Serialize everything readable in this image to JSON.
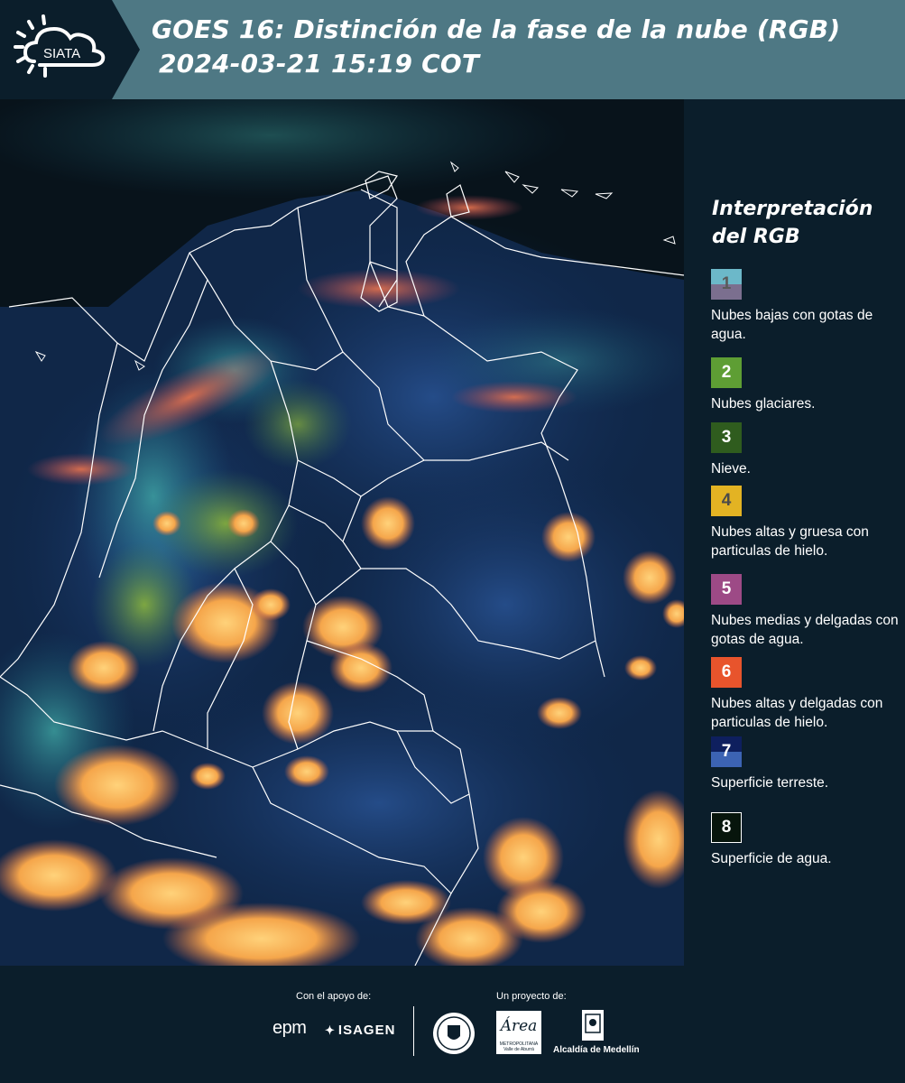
{
  "header": {
    "logo_text": "SIATA",
    "title_line1": "GOES 16: Distinción de la fase de la nube (RGB)",
    "title_line2": "2024-03-21 15:19 COT"
  },
  "legend": {
    "title_line1": "Interpretación",
    "title_line2": "del RGB",
    "items": [
      {
        "number": "1",
        "label": "Nubes bajas con gotas de agua.",
        "color_top": "#6cb8c9",
        "color_bottom": "#7b6f8f",
        "number_color": "#5a5a5a"
      },
      {
        "number": "2",
        "label": "Nubes glaciares.",
        "color_top": "#5e9e34",
        "color_bottom": "#5e9e34",
        "number_color": "#ffffff"
      },
      {
        "number": "3",
        "label": "Nieve.",
        "color_top": "#2f5c1e",
        "color_bottom": "#2f5c1e",
        "number_color": "#ffffff"
      },
      {
        "number": "4",
        "label": "Nubes altas y gruesa con particulas de hielo.",
        "color_top": "#e3b323",
        "color_bottom": "#e3b323",
        "number_color": "#4a4a4a"
      },
      {
        "number": "5",
        "label": "Nubes medias y delgadas con gotas de agua.",
        "color_top": "#9d4a86",
        "color_bottom": "#9d4a86",
        "number_color": "#ffffff"
      },
      {
        "number": "6",
        "label": "Nubes altas y delgadas con particulas de hielo.",
        "color_top": "#e8542c",
        "color_bottom": "#e8542c",
        "number_color": "#ffffff"
      },
      {
        "number": "7",
        "label": "Superficie terreste.",
        "color_top": "#0e1f5e",
        "color_bottom": "#3c63b3",
        "number_color": "#ffffff"
      },
      {
        "number": "8",
        "label": "Superficie de agua.",
        "color_top": "#07150c",
        "color_bottom": "#07150c",
        "number_color": "#ffffff"
      }
    ]
  },
  "footer": {
    "support_label": "Con el apoyo de:",
    "project_label": "Un proyecto de:",
    "sponsors": [
      "epm",
      "ISAGEN"
    ],
    "area_logo_text": "Área",
    "area_logo_subtext": "METROPOLITANA Valle de Aburrá",
    "alcaldia": "Alcaldía de Medellín"
  },
  "colors": {
    "background": "#0b1e2b",
    "header_bar": "#4e7884",
    "cloud_orange": "#f2a447",
    "cloud_pink": "#e66a4a",
    "land_blue": "#1b3a6b",
    "border_white": "#ffffff"
  }
}
